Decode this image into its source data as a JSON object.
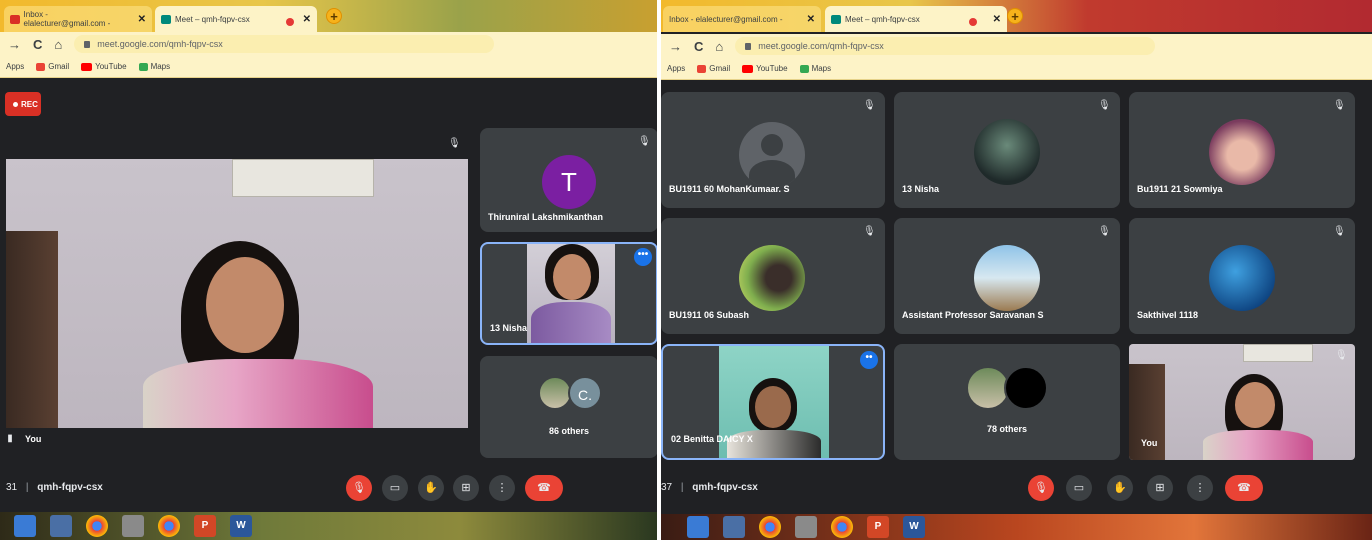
{
  "left": {
    "tabs": [
      {
        "title": "Inbox - elalecturer@gmail.com -",
        "close": "✕"
      },
      {
        "title": "Meet – qmh-fqpv-csx",
        "close": "✕"
      }
    ],
    "new_tab": "+",
    "url": "meet.google.com/qmh-fqpv-csx",
    "bookmarks": [
      "Apps",
      "Gmail",
      "YouTube",
      "Maps"
    ],
    "rec_label": "REC",
    "main_tile_name": "You",
    "side_tiles": [
      {
        "name": "Thiruniral Lakshmikanthan",
        "avatar_letter": "T",
        "avatar_color": "#7b1fa2"
      },
      {
        "name": "13 Nisha"
      },
      {
        "name": "86 others",
        "avatar_letter": "C."
      }
    ],
    "time_fragment": "31",
    "meeting_code": "qmh-fqpv-csx"
  },
  "right": {
    "tabs": [
      {
        "title": "Inbox - elalecturer@gmail.com -",
        "close": "✕"
      },
      {
        "title": "Meet – qmh-fqpv-csx",
        "close": "✕"
      }
    ],
    "new_tab": "+",
    "url": "meet.google.com/qmh-fqpv-csx",
    "bookmarks": [
      "Apps",
      "Gmail",
      "YouTube",
      "Maps"
    ],
    "tiles": [
      {
        "name": "BU1911 60 MohanKumaar. S"
      },
      {
        "name": "13 Nisha"
      },
      {
        "name": "Bu1911 21 Sowmiya"
      },
      {
        "name": "BU1911 06 Subash"
      },
      {
        "name": "Assistant Professor Saravanan S"
      },
      {
        "name": "Sakthivel 1118"
      },
      {
        "name": "02 Benitta DAICY X"
      },
      {
        "name": "78 others"
      },
      {
        "name": "You"
      }
    ],
    "time_fragment": "37",
    "meeting_code": "qmh-fqpv-csx"
  },
  "colors": {
    "meet_bg": "#202124",
    "tile_bg": "#3c4043",
    "accent_red": "#ea4335",
    "highlight_blue": "#8ab4f8"
  }
}
